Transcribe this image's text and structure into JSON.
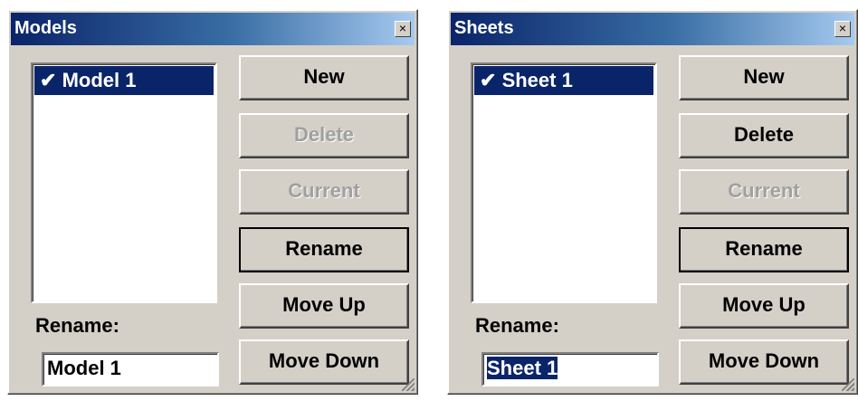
{
  "models": {
    "title": "Models",
    "close_label": "×",
    "items": [
      {
        "check": "✔",
        "label": "Model 1"
      }
    ],
    "buttons": {
      "new": "New",
      "delete": "Delete",
      "current": "Current",
      "rename": "Rename",
      "move_up": "Move Up",
      "move_down": "Move Down"
    },
    "rename_label": "Rename:",
    "rename_value": "Model 1"
  },
  "sheets": {
    "title": "Sheets",
    "close_label": "×",
    "items": [
      {
        "check": "✔",
        "label": "Sheet 1"
      }
    ],
    "buttons": {
      "new": "New",
      "delete": "Delete",
      "current": "Current",
      "rename": "Rename",
      "move_up": "Move Up",
      "move_down": "Move Down"
    },
    "rename_label": "Rename:",
    "rename_value": "Sheet 1"
  }
}
